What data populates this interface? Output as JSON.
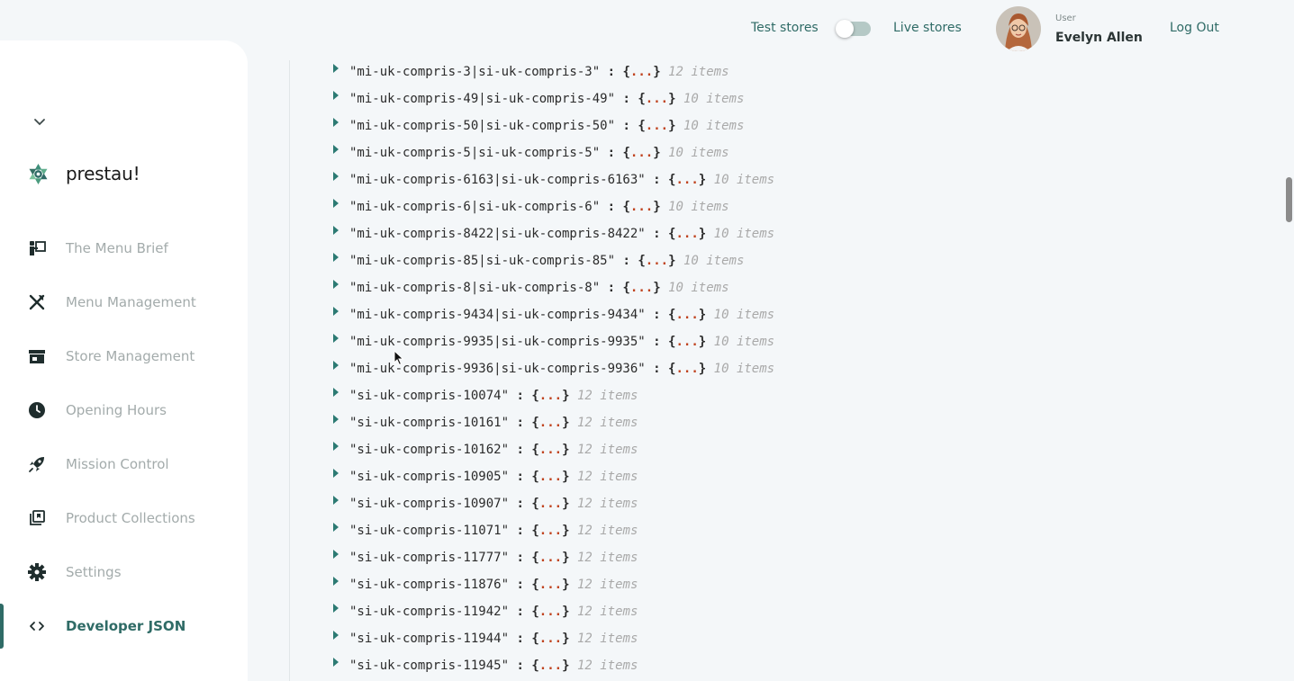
{
  "header": {
    "test_stores_label": "Test stores",
    "live_stores_label": "Live stores",
    "toggle_state": "test",
    "user_caption": "User",
    "user_name": "Evelyn Allen",
    "logout_label": "Log Out"
  },
  "sidebar": {
    "brand_name": "prestau!",
    "items": [
      {
        "label": "The Menu Brief",
        "icon": "presenter-icon"
      },
      {
        "label": "Menu Management",
        "icon": "utensils-icon"
      },
      {
        "label": "Store Management",
        "icon": "storefront-icon"
      },
      {
        "label": "Opening Hours",
        "icon": "clock-icon"
      },
      {
        "label": "Mission Control",
        "icon": "rocket-icon"
      },
      {
        "label": "Product Collections",
        "icon": "collections-icon"
      },
      {
        "label": "Settings",
        "icon": "gear-icon"
      },
      {
        "label": "Developer JSON",
        "icon": "code-icon",
        "active": true
      }
    ]
  },
  "json_view": {
    "rows": [
      {
        "key": "\"mi-uk-compris-3|si-uk-compris-3\"",
        "ellipsis": "...",
        "count": "12 items"
      },
      {
        "key": "\"mi-uk-compris-49|si-uk-compris-49\"",
        "ellipsis": "...",
        "count": "10 items"
      },
      {
        "key": "\"mi-uk-compris-50|si-uk-compris-50\"",
        "ellipsis": "...",
        "count": "10 items"
      },
      {
        "key": "\"mi-uk-compris-5|si-uk-compris-5\"",
        "ellipsis": "...",
        "count": "10 items"
      },
      {
        "key": "\"mi-uk-compris-6163|si-uk-compris-6163\"",
        "ellipsis": "...",
        "count": "10 items"
      },
      {
        "key": "\"mi-uk-compris-6|si-uk-compris-6\"",
        "ellipsis": "...",
        "count": "10 items"
      },
      {
        "key": "\"mi-uk-compris-8422|si-uk-compris-8422\"",
        "ellipsis": "...",
        "count": "10 items"
      },
      {
        "key": "\"mi-uk-compris-85|si-uk-compris-85\"",
        "ellipsis": "...",
        "count": "10 items"
      },
      {
        "key": "\"mi-uk-compris-8|si-uk-compris-8\"",
        "ellipsis": "...",
        "count": "10 items"
      },
      {
        "key": "\"mi-uk-compris-9434|si-uk-compris-9434\"",
        "ellipsis": "...",
        "count": "10 items"
      },
      {
        "key": "\"mi-uk-compris-9935|si-uk-compris-9935\"",
        "ellipsis": "...",
        "count": "10 items"
      },
      {
        "key": "\"mi-uk-compris-9936|si-uk-compris-9936\"",
        "ellipsis": "...",
        "count": "10 items"
      },
      {
        "key": "\"si-uk-compris-10074\"",
        "ellipsis": "...",
        "count": "12 items"
      },
      {
        "key": "\"si-uk-compris-10161\"",
        "ellipsis": "...",
        "count": "12 items"
      },
      {
        "key": "\"si-uk-compris-10162\"",
        "ellipsis": "...",
        "count": "12 items"
      },
      {
        "key": "\"si-uk-compris-10905\"",
        "ellipsis": "...",
        "count": "12 items"
      },
      {
        "key": "\"si-uk-compris-10907\"",
        "ellipsis": "...",
        "count": "12 items"
      },
      {
        "key": "\"si-uk-compris-11071\"",
        "ellipsis": "...",
        "count": "12 items"
      },
      {
        "key": "\"si-uk-compris-11777\"",
        "ellipsis": "...",
        "count": "12 items"
      },
      {
        "key": "\"si-uk-compris-11876\"",
        "ellipsis": "...",
        "count": "12 items"
      },
      {
        "key": "\"si-uk-compris-11942\"",
        "ellipsis": "...",
        "count": "12 items"
      },
      {
        "key": "\"si-uk-compris-11944\"",
        "ellipsis": "...",
        "count": "12 items"
      },
      {
        "key": "\"si-uk-compris-11945\"",
        "ellipsis": "...",
        "count": "12 items"
      }
    ]
  },
  "colors": {
    "accent": "#2f6b66",
    "json_ellipsis": "#c0431f",
    "json_count": "#a9a9a9",
    "sidebar_inactive": "#a3abab"
  }
}
